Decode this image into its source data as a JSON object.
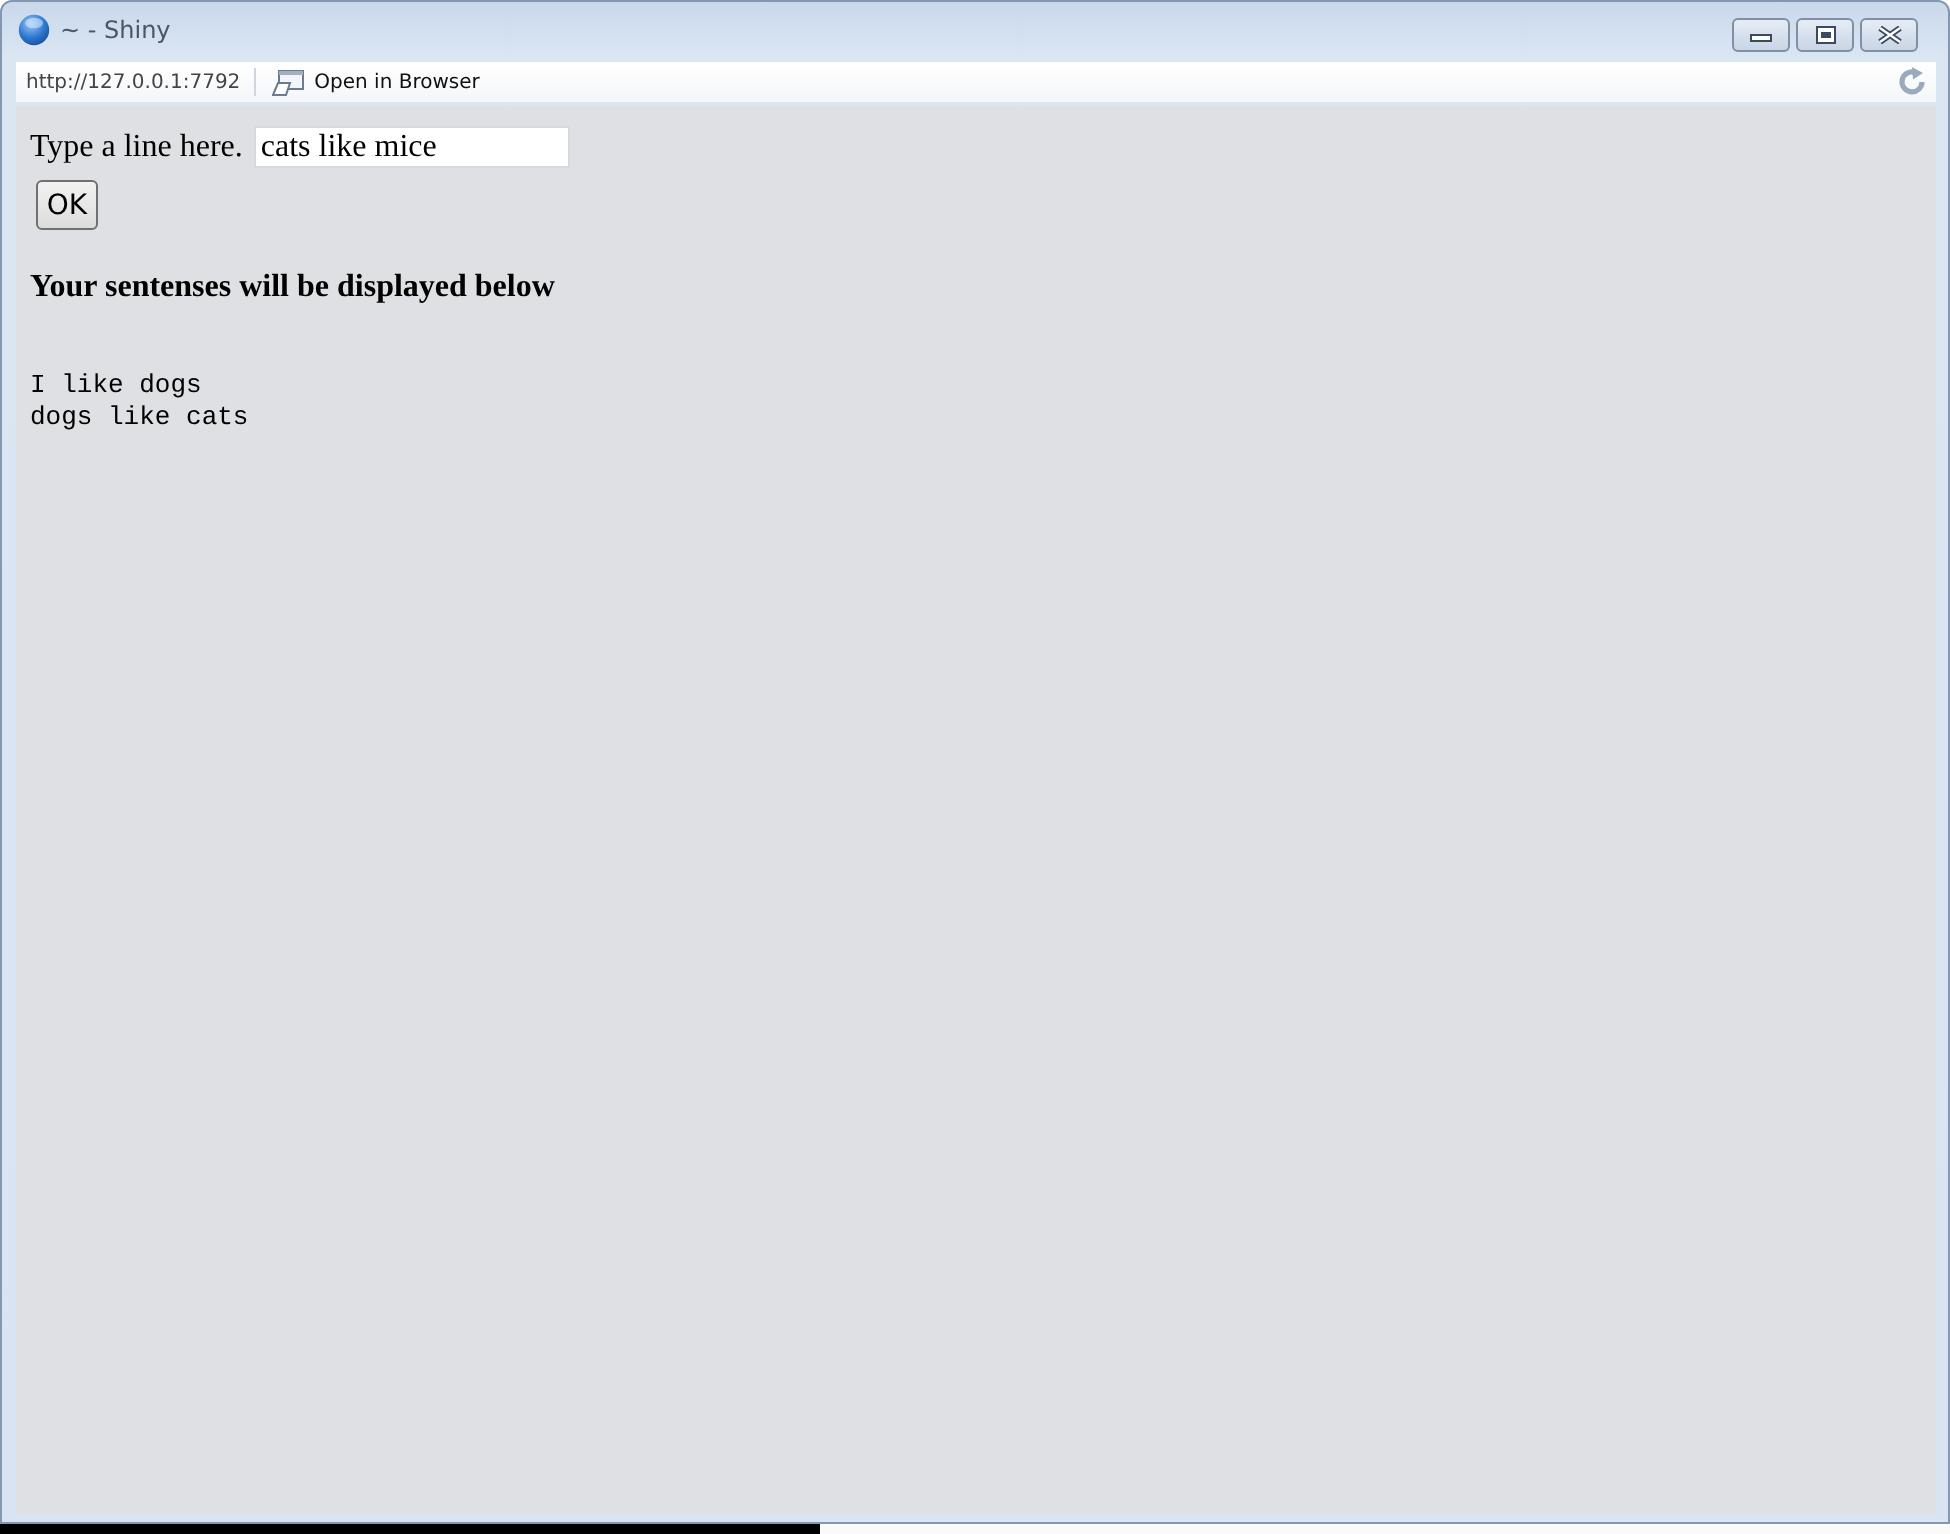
{
  "window": {
    "title": "~ - Shiny"
  },
  "address_bar": {
    "url": "http://127.0.0.1:7792",
    "open_button": "Open in Browser"
  },
  "form": {
    "label": "Type a line here.",
    "input": {
      "value": "cats like mice"
    },
    "button": "OK"
  },
  "output": {
    "heading": "Your sentenses will be displayed below",
    "lines": [
      "I like dogs",
      "dogs like cats"
    ]
  }
}
